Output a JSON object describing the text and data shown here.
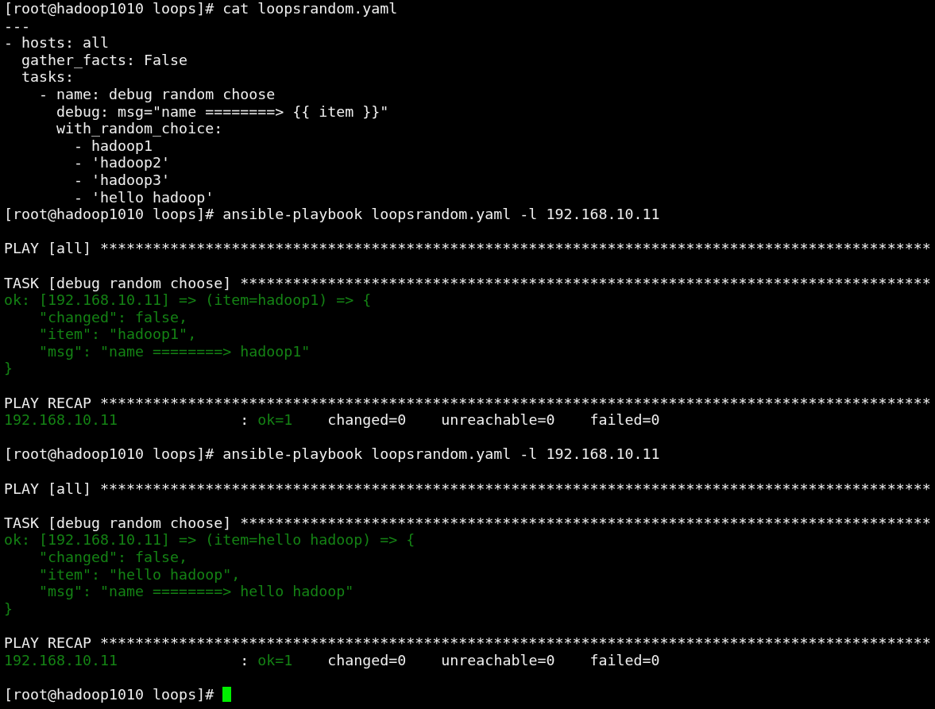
{
  "terminal": {
    "cursor_visible": true,
    "blocks": [
      [
        {
          "segments": [
            {
              "text": "[root@hadoop1010 loops]# cat loopsrandom.yaml",
              "color": "#eeeeee"
            }
          ]
        },
        {
          "segments": [
            {
              "text": "---",
              "color": "#eeeeee"
            }
          ]
        },
        {
          "segments": [
            {
              "text": "- hosts: all",
              "color": "#eeeeee"
            }
          ]
        },
        {
          "segments": [
            {
              "text": "  gather_facts: False",
              "color": "#eeeeee"
            }
          ]
        },
        {
          "segments": [
            {
              "text": "  tasks:",
              "color": "#eeeeee"
            }
          ]
        },
        {
          "segments": [
            {
              "text": "    - name: debug random choose",
              "color": "#eeeeee"
            }
          ]
        },
        {
          "segments": [
            {
              "text": "      debug: msg=\"name ========> {{ item }}\"",
              "color": "#eeeeee"
            }
          ]
        },
        {
          "segments": [
            {
              "text": "      with_random_choice:",
              "color": "#eeeeee"
            }
          ]
        },
        {
          "segments": [
            {
              "text": "        - hadoop1",
              "color": "#eeeeee"
            }
          ]
        },
        {
          "segments": [
            {
              "text": "        - 'hadoop2'",
              "color": "#eeeeee"
            }
          ]
        },
        {
          "segments": [
            {
              "text": "        - 'hadoop3'",
              "color": "#eeeeee"
            }
          ]
        },
        {
          "segments": [
            {
              "text": "        - 'hello hadoop'",
              "color": "#eeeeee"
            }
          ]
        },
        {
          "segments": [
            {
              "text": "[root@hadoop1010 loops]# ansible-playbook loopsrandom.yaml -l 192.168.10.11",
              "color": "#eeeeee"
            }
          ]
        }
      ],
      [
        {
          "segments": [
            {
              "text": "PLAY [all] ***********************************************************************************************",
              "color": "#eeeeee"
            }
          ]
        }
      ],
      [
        {
          "segments": [
            {
              "text": "TASK [debug random choose] *******************************************************************************",
              "color": "#eeeeee"
            }
          ]
        },
        {
          "segments": [
            {
              "text": "ok: [192.168.10.11] => (item=hadoop1) => {",
              "color": "#148214"
            }
          ]
        },
        {
          "segments": [
            {
              "text": "    \"changed\": false,",
              "color": "#148214"
            }
          ]
        },
        {
          "segments": [
            {
              "text": "    \"item\": \"hadoop1\",",
              "color": "#148214"
            }
          ]
        },
        {
          "segments": [
            {
              "text": "    \"msg\": \"name ========> hadoop1\"",
              "color": "#148214"
            }
          ]
        },
        {
          "segments": [
            {
              "text": "}",
              "color": "#148214"
            }
          ]
        }
      ],
      [
        {
          "segments": [
            {
              "text": "PLAY RECAP ***********************************************************************************************",
              "color": "#eeeeee"
            }
          ]
        },
        {
          "segments": [
            {
              "text": "192.168.10.11",
              "color": "#148214"
            },
            {
              "text": "              : ",
              "color": "#eeeeee"
            },
            {
              "text": "ok=1",
              "color": "#148214"
            },
            {
              "text": "    changed=0    unreachable=0    failed=0",
              "color": "#eeeeee"
            }
          ]
        }
      ],
      [
        {
          "segments": [
            {
              "text": "[root@hadoop1010 loops]# ansible-playbook loopsrandom.yaml -l 192.168.10.11",
              "color": "#eeeeee"
            }
          ]
        }
      ],
      [
        {
          "segments": [
            {
              "text": "PLAY [all] ***********************************************************************************************",
              "color": "#eeeeee"
            }
          ]
        }
      ],
      [
        {
          "segments": [
            {
              "text": "TASK [debug random choose] *******************************************************************************",
              "color": "#eeeeee"
            }
          ]
        },
        {
          "segments": [
            {
              "text": "ok: [192.168.10.11] => (item=hello hadoop) => {",
              "color": "#148214"
            }
          ]
        },
        {
          "segments": [
            {
              "text": "    \"changed\": false,",
              "color": "#148214"
            }
          ]
        },
        {
          "segments": [
            {
              "text": "    \"item\": \"hello hadoop\",",
              "color": "#148214"
            }
          ]
        },
        {
          "segments": [
            {
              "text": "    \"msg\": \"name ========> hello hadoop\"",
              "color": "#148214"
            }
          ]
        },
        {
          "segments": [
            {
              "text": "}",
              "color": "#148214"
            }
          ]
        }
      ],
      [
        {
          "segments": [
            {
              "text": "PLAY RECAP ***********************************************************************************************",
              "color": "#eeeeee"
            }
          ]
        },
        {
          "segments": [
            {
              "text": "192.168.10.11",
              "color": "#148214"
            },
            {
              "text": "              : ",
              "color": "#eeeeee"
            },
            {
              "text": "ok=1",
              "color": "#148214"
            },
            {
              "text": "    changed=0    unreachable=0    failed=0",
              "color": "#eeeeee"
            }
          ]
        }
      ],
      [
        {
          "segments": [
            {
              "text": "[root@hadoop1010 loops]# ",
              "color": "#eeeeee"
            }
          ]
        }
      ]
    ]
  }
}
